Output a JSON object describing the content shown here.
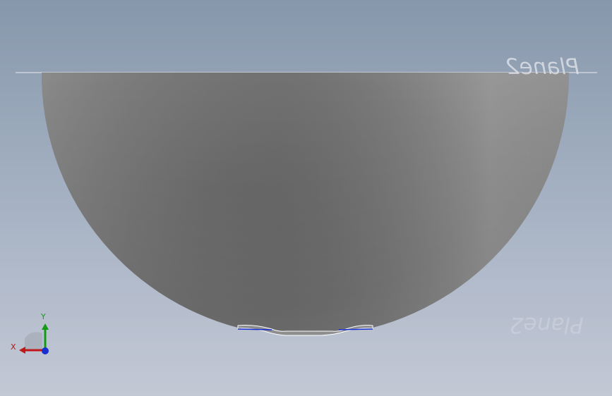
{
  "viewport": {
    "plane_top_label": "Plane2",
    "plane_bottom_label": "Plane2"
  },
  "triad": {
    "x_label": "X",
    "y_label": "Y",
    "colors": {
      "x_axis": "#c01818",
      "y_axis": "#139a13",
      "z_axis": "#1a2fd0"
    }
  },
  "model": {
    "icon": "hemisphere-part",
    "body_color": "#7a7a7a",
    "edge_highlight_color": "#1a2fd0"
  }
}
